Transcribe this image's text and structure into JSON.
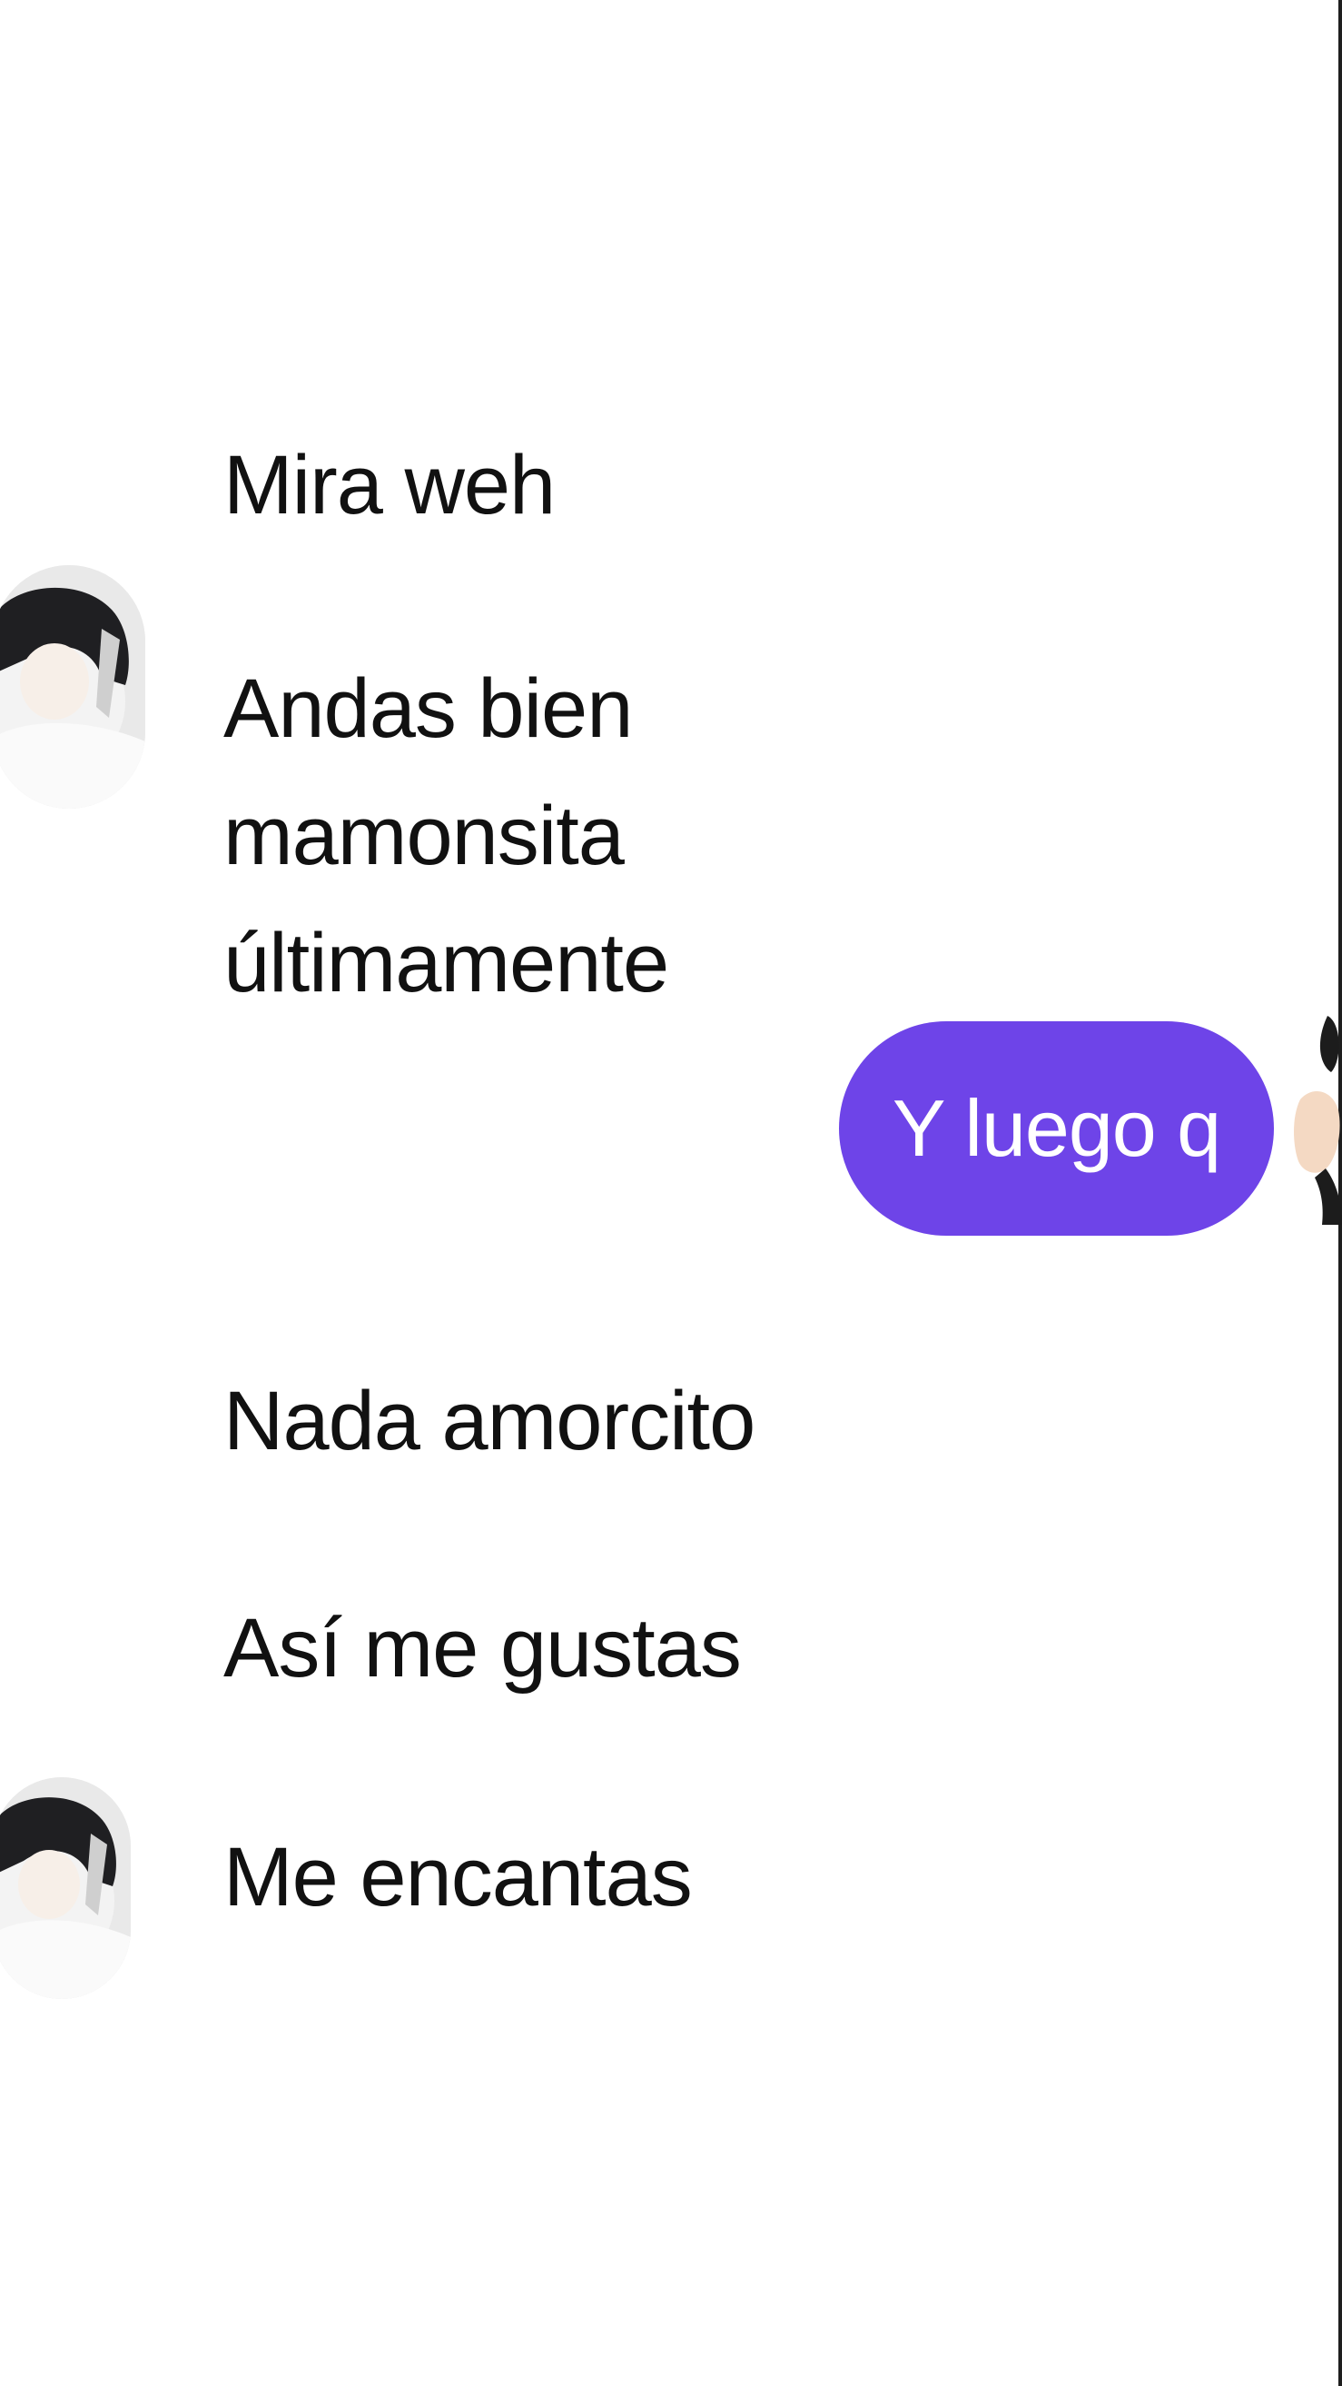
{
  "conversation": {
    "incoming_group_1": [
      {
        "text": "Mira weh"
      },
      {
        "text": "Andas bien mamonsita últimamente"
      }
    ],
    "outgoing": [
      {
        "text": "Y luego q"
      }
    ],
    "incoming_group_2": [
      {
        "text": "Nada amorcito"
      },
      {
        "text": "Así me gustas"
      },
      {
        "text": "Me encantas"
      }
    ]
  },
  "avatar_icon": "profile-photo-avatar",
  "reaction_icon": "wave-hand-icon",
  "colors": {
    "background": "#ffffff",
    "outgoing_bubble": "#6e44e8",
    "outgoing_text": "#ffffff",
    "incoming_text": "#111111"
  }
}
